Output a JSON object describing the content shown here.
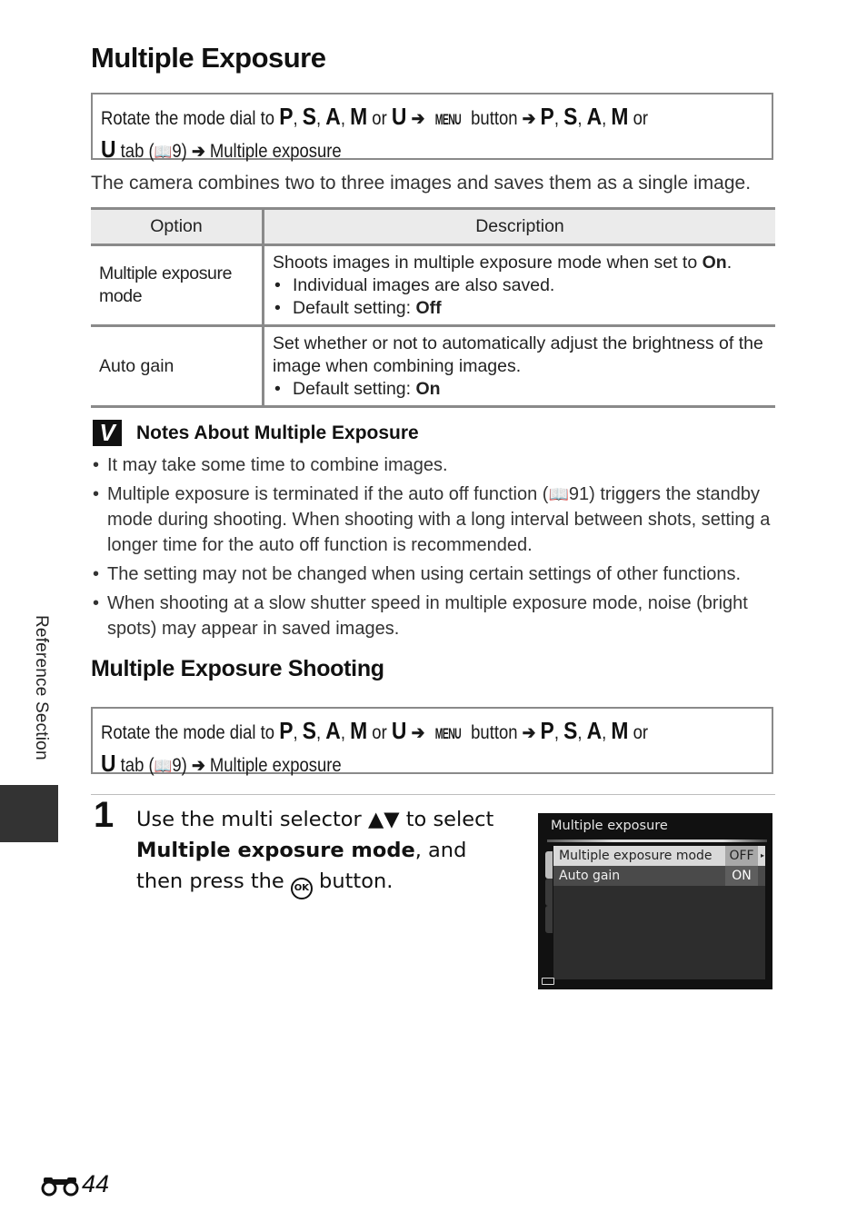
{
  "page": {
    "title": "Multiple Exposure",
    "nav_path": {
      "prefix": "Rotate the mode dial to",
      "modes": [
        "P",
        "S",
        "A",
        "M"
      ],
      "or_word": "or",
      "last_mode": "U",
      "menu_label": "MENU",
      "button_word": "button",
      "tab_word": "tab",
      "page_ref": "9",
      "destination": "Multiple exposure",
      "book_icon": "book-icon",
      "arrow_icon": "right-arrow-icon"
    },
    "intro": "The camera combines two to three images and saves them as a single image.",
    "table": {
      "headers": [
        "Option",
        "Description"
      ],
      "rows": [
        {
          "option": "Multiple exposure mode",
          "description_main": "Shoots images in multiple exposure mode when set to ",
          "description_bold": "On",
          "description_end": ".",
          "bullets": [
            {
              "text": "Individual images are also saved.",
              "bold": ""
            },
            {
              "text": "Default setting: ",
              "bold": "Off"
            }
          ]
        },
        {
          "option": "Auto gain",
          "description_main": "Set whether or not to automatically adjust the brightness of the image when combining images.",
          "description_bold": "",
          "description_end": "",
          "bullets": [
            {
              "text": "Default setting: ",
              "bold": "On"
            }
          ]
        }
      ]
    },
    "notes": {
      "heading": "Notes About Multiple Exposure",
      "icon": "checkmark-icon",
      "items": [
        "It may take some time to combine images.",
        "Multiple exposure is terminated if the auto off function (",
        "The setting may not be changed when using certain settings of other functions.",
        "When shooting at a slow shutter speed in multiple exposure mode, noise (bright spots) may appear in saved images."
      ],
      "item2_ref": "91",
      "item2_rest": ") triggers the standby mode during shooting. When shooting with a long interval between shots, setting a longer time for the auto off function is recommended."
    },
    "section": {
      "title": "Multiple Exposure Shooting"
    },
    "step": {
      "number": "1",
      "line1": "Use the multi selector ",
      "arrows": "▲▼",
      "line1_end": " to select ",
      "bold": "Multiple exposure mode",
      "line2": ", and then press the ",
      "ok_label": "OK",
      "line3": " button."
    },
    "camera_screen": {
      "title": "Multiple exposure",
      "rows": [
        {
          "label": "Multiple exposure mode",
          "value": "OFF",
          "selected": true
        },
        {
          "label": "Auto gain",
          "value": "ON",
          "selected": false
        }
      ]
    },
    "side_tab": "Reference Section",
    "footer": {
      "page_number": "44",
      "icon": "binoculars-icon"
    }
  }
}
